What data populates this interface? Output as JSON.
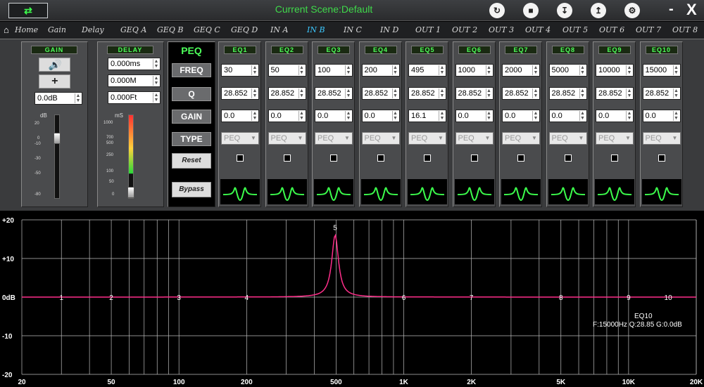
{
  "titlebar": {
    "usb_icon": "usb-icon",
    "scene_text": "Current Scene:Default",
    "icons": [
      "refresh-icon",
      "save-icon",
      "import-icon",
      "export-icon",
      "settings-icon"
    ],
    "minimize": "-",
    "close": "X"
  },
  "nav": {
    "home": "Home",
    "items": [
      "Gain",
      "Delay",
      "GEQ A",
      "GEQ B",
      "GEQ C",
      "GEQ D",
      "IN A",
      "IN B",
      "IN C",
      "IN D",
      "OUT 1",
      "OUT 2",
      "OUT 3",
      "OUT 4",
      "OUT 5",
      "OUT 6",
      "OUT 7",
      "OUT 8"
    ],
    "active": "IN B"
  },
  "gain": {
    "header": "GAIN",
    "value": "0.0dB",
    "unit": "dB",
    "scale": [
      "20",
      "0",
      "-10",
      "-30",
      "-50",
      "-80"
    ]
  },
  "delay": {
    "header": "DELAY",
    "ms": "0.000ms",
    "m": "0.000M",
    "ft": "0.000Ft",
    "unit": "mS",
    "scale": [
      "1000",
      "700",
      "500",
      "250",
      "100",
      "50",
      "0"
    ]
  },
  "peq": {
    "title": "PEQ",
    "freq": "FREQ",
    "q": "Q",
    "gain": "GAIN",
    "type": "TYPE",
    "reset": "Reset",
    "bypass": "Bypass"
  },
  "bands": [
    {
      "name": "EQ1",
      "freq": "30",
      "q": "28.852",
      "gain": "0.0",
      "type": "PEQ"
    },
    {
      "name": "EQ2",
      "freq": "50",
      "q": "28.852",
      "gain": "0.0",
      "type": "PEQ"
    },
    {
      "name": "EQ3",
      "freq": "100",
      "q": "28.852",
      "gain": "0.0",
      "type": "PEQ"
    },
    {
      "name": "EQ4",
      "freq": "200",
      "q": "28.852",
      "gain": "0.0",
      "type": "PEQ"
    },
    {
      "name": "EQ5",
      "freq": "495",
      "q": "28.852",
      "gain": "16.1",
      "type": "PEQ"
    },
    {
      "name": "EQ6",
      "freq": "1000",
      "q": "28.852",
      "gain": "0.0",
      "type": "PEQ"
    },
    {
      "name": "EQ7",
      "freq": "2000",
      "q": "28.852",
      "gain": "0.0",
      "type": "PEQ"
    },
    {
      "name": "EQ8",
      "freq": "5000",
      "q": "28.852",
      "gain": "0.0",
      "type": "PEQ"
    },
    {
      "name": "EQ9",
      "freq": "10000",
      "q": "28.852",
      "gain": "0.0",
      "type": "PEQ"
    },
    {
      "name": "EQ10",
      "freq": "15000",
      "q": "28.852",
      "gain": "0.0",
      "type": "PEQ"
    }
  ],
  "graph": {
    "y_labels": [
      "+20",
      "+10",
      "0dB",
      "-10",
      "-20"
    ],
    "x_labels": [
      "20",
      "50",
      "100",
      "200",
      "500",
      "1K",
      "2K",
      "5K",
      "10K",
      "20K"
    ],
    "x_label_values": [
      20,
      50,
      100,
      200,
      500,
      1000,
      2000,
      5000,
      10000,
      20000
    ],
    "band_markers": [
      {
        "label": "1",
        "freq": 30
      },
      {
        "label": "2",
        "freq": 50
      },
      {
        "label": "3",
        "freq": 100
      },
      {
        "label": "4",
        "freq": 200
      },
      {
        "label": "5",
        "freq": 495
      },
      {
        "label": "6",
        "freq": 1000
      },
      {
        "label": "7",
        "freq": 2000
      },
      {
        "label": "8",
        "freq": 5000
      },
      {
        "label": "9",
        "freq": 10000
      },
      {
        "label": "10",
        "freq": 15000
      }
    ],
    "selected_band": "EQ10",
    "selected_info": "F:15000Hz  Q:28.85  G:0.0dB",
    "curve_color": "#ff2e8a",
    "peak_freq": 495,
    "peak_gain_db": 16.1
  }
}
